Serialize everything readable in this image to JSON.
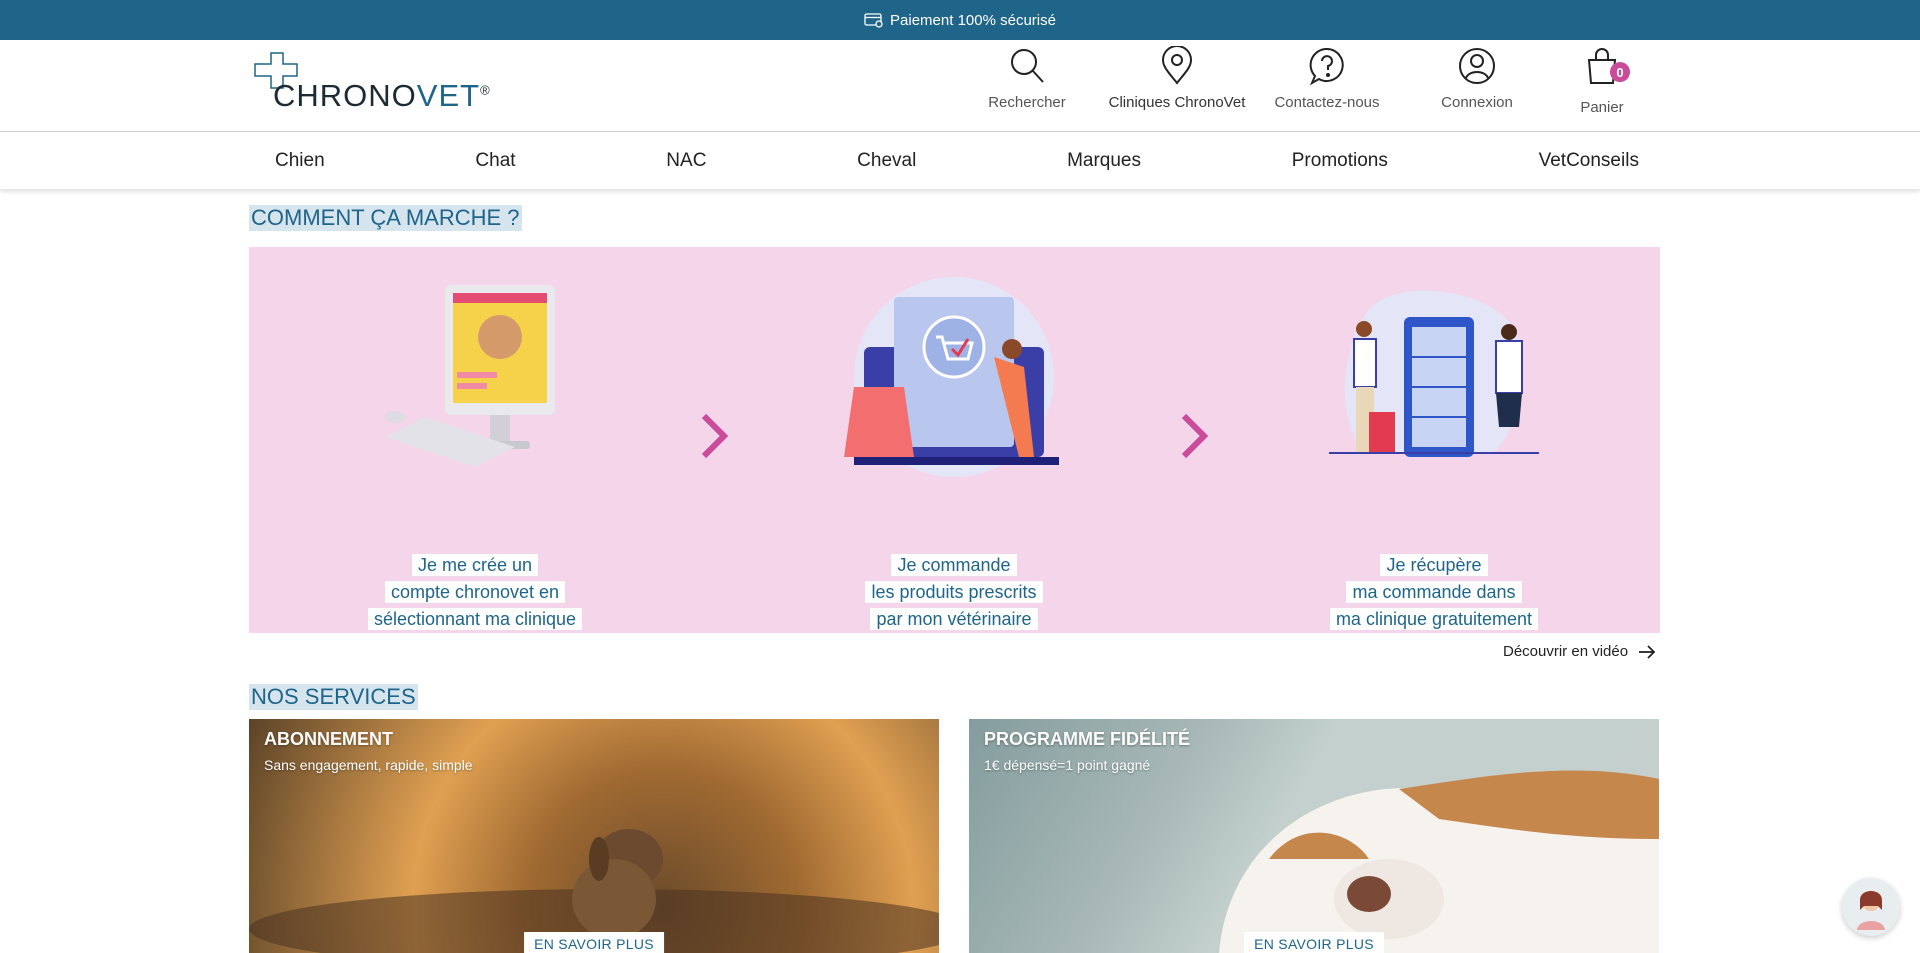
{
  "topbar": {
    "text": "Paiement 100% sécurisé"
  },
  "logo": {
    "text_main": "CHRONO",
    "text_accent": "VET",
    "reg": "®"
  },
  "header_actions": [
    {
      "label": "Rechercher",
      "icon": "search-icon"
    },
    {
      "label": "Cliniques ChronoVet",
      "icon": "map-pin-icon"
    },
    {
      "label": "Contactez-nous",
      "icon": "question-bubble-icon"
    },
    {
      "label": "Connexion",
      "icon": "user-icon"
    },
    {
      "label": "Panier",
      "icon": "shopping-bag-icon",
      "badge": "0"
    }
  ],
  "nav": [
    "Chien",
    "Chat",
    "NAC",
    "Cheval",
    "Marques",
    "Promotions",
    "VetConseils"
  ],
  "how_it_works": {
    "title": "COMMENT ÇA MARCHE ?",
    "steps": [
      {
        "lines": [
          "Je me crée un",
          "compte chronovet en",
          "sélectionnant ma clinique"
        ]
      },
      {
        "lines": [
          "Je commande",
          "les produits prescrits",
          "par mon vétérinaire"
        ]
      },
      {
        "lines": [
          "Je récupère",
          "ma commande dans",
          "ma clinique gratuitement"
        ]
      }
    ],
    "video_link": "Découvrir en vidéo"
  },
  "services": {
    "title": "NOS SERVICES",
    "cards": [
      {
        "title": "ABONNEMENT",
        "subtitle": "Sans engagement, rapide, simple",
        "button": "EN SAVOIR PLUS"
      },
      {
        "title": "PROGRAMME FIDÉLITÉ",
        "subtitle": "1€ dépensé=1 point gagné",
        "button": "EN SAVOIR PLUS"
      }
    ]
  },
  "colors": {
    "primary": "#1e6589",
    "accent": "#c94b9a",
    "pink_bg": "#f5d5ea"
  }
}
